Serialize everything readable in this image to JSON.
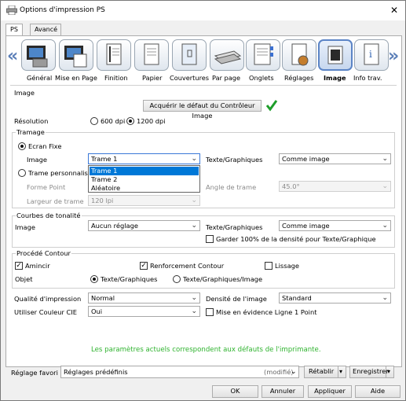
{
  "window": {
    "title": "Options d'impression PS",
    "close_glyph": "✕"
  },
  "tabs": [
    {
      "label": "PS"
    },
    {
      "label": "Avancé"
    }
  ],
  "nav": {
    "items": [
      {
        "label": "Général"
      },
      {
        "label": "Mise en Page"
      },
      {
        "label": "Finition"
      },
      {
        "label": "Papier"
      },
      {
        "label": "Couvertures"
      },
      {
        "label": "Par page"
      },
      {
        "label": "Onglets"
      },
      {
        "label": "Réglages"
      },
      {
        "label": "Image"
      },
      {
        "label": "Info trav."
      }
    ],
    "prev_glyph": "«",
    "next_glyph": "»"
  },
  "image_section": {
    "title": "Image",
    "acquire_button": "Acquérir le défaut du Contrôleur Image",
    "resolution_label": "Résolution",
    "res_600": "600 dpi",
    "res_1200": "1200 dpi"
  },
  "tramage": {
    "title": "Tramage",
    "ecran_fixe": "Ecran Fixe",
    "image_label": "Image",
    "image_value": "Trame 1",
    "texte_graphiques_label": "Texte/Graphiques",
    "texte_graphiques_value": "Comme image",
    "trame_perso": "Trame personnalisée",
    "forme_point_label": "Forme Point",
    "angle_label": "Angle de trame",
    "angle_value": "45.0°",
    "largeur_label": "Largeur de trame",
    "largeur_value": "120 lpi",
    "dropdown_options": [
      "Trame 1",
      "Trame 2",
      "Aléatoire"
    ]
  },
  "courbes": {
    "title": "Courbes de tonalité",
    "image_label": "Image",
    "image_value": "Aucun réglage",
    "texte_label": "Texte/Graphiques",
    "texte_value": "Comme image",
    "garder_label": "Garder 100% de la densité pour Texte/Graphique"
  },
  "contour": {
    "title": "Procédé Contour",
    "amincir": "Amincir",
    "renforcement": "Renforcement Contour",
    "lissage": "Lissage",
    "objet_label": "Objet",
    "obj_texte": "Texte/Graphiques",
    "obj_texte_image": "Texte/Graphiques/Image"
  },
  "quality": {
    "qualite_label": "Qualité d'impression",
    "qualite_value": "Normal",
    "densite_label": "Densité de l'image",
    "densite_value": "Standard",
    "couleur_label": "Utiliser Couleur CIE",
    "couleur_value": "Oui",
    "mise_label": "Mise en évidence Ligne 1 Point"
  },
  "status_message": "Les paramètres actuels correspondent aux défauts de l'imprimante.",
  "favorites": {
    "label": "Réglage favori",
    "value": "Réglages prédéfinis",
    "modified": "(modifié)",
    "retablir": "Rétablir",
    "enregistrer": "Enregistrer"
  },
  "buttons": {
    "ok": "OK",
    "annuler": "Annuler",
    "appliquer": "Appliquer",
    "aide": "Aide"
  },
  "colors": {
    "accent": "#0078d7",
    "status_green": "#2fb32f",
    "nav_selected": "#5b84c6",
    "check_green": "#1e9e2a"
  }
}
